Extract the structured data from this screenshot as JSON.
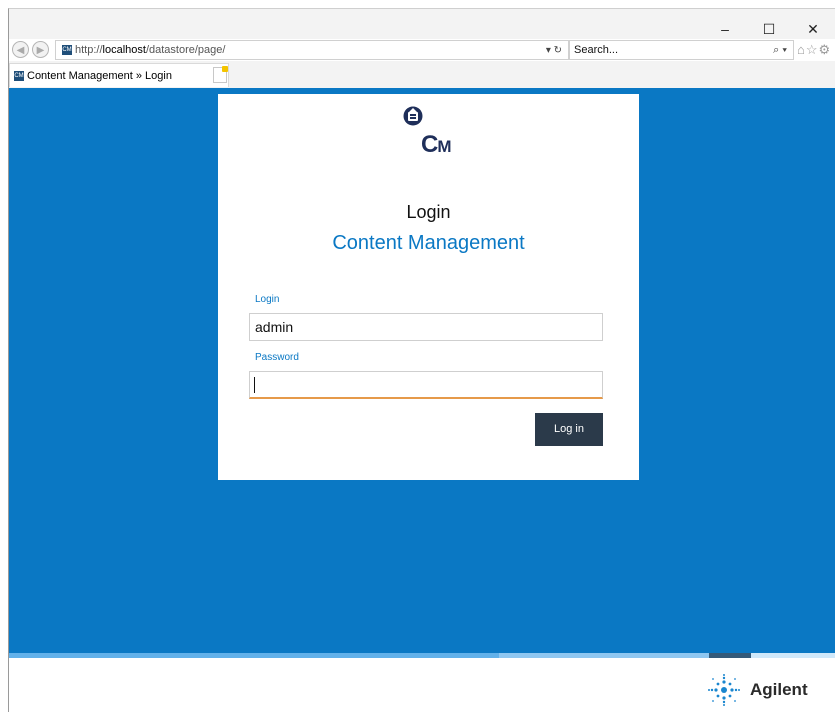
{
  "browser": {
    "address_protocol": "http://",
    "address_host": "localhost",
    "address_path": "/datastore/page/",
    "address_controls": "▾ ↻",
    "search_placeholder": "Search...",
    "search_controls": "⌕ ▾",
    "toolbar_icons": "⌂☆⚙",
    "tab_title": "Content Management » Login",
    "tab_close": "×",
    "favicon_text": "CM",
    "window_controls": [
      "–",
      "☐",
      "✕"
    ]
  },
  "login_card": {
    "logo_letters": "C",
    "logo_small": "M",
    "title": "Login",
    "subtitle": "Content Management",
    "login_label": "Login",
    "login_value": "admin",
    "password_label": "Password",
    "password_value": "",
    "submit_label": "Log in"
  },
  "footer": {
    "brand": "Agilent"
  },
  "colors": {
    "accent": "#0a78c4",
    "button": "#2b3a4a",
    "focus_border": "#e69a4a"
  }
}
